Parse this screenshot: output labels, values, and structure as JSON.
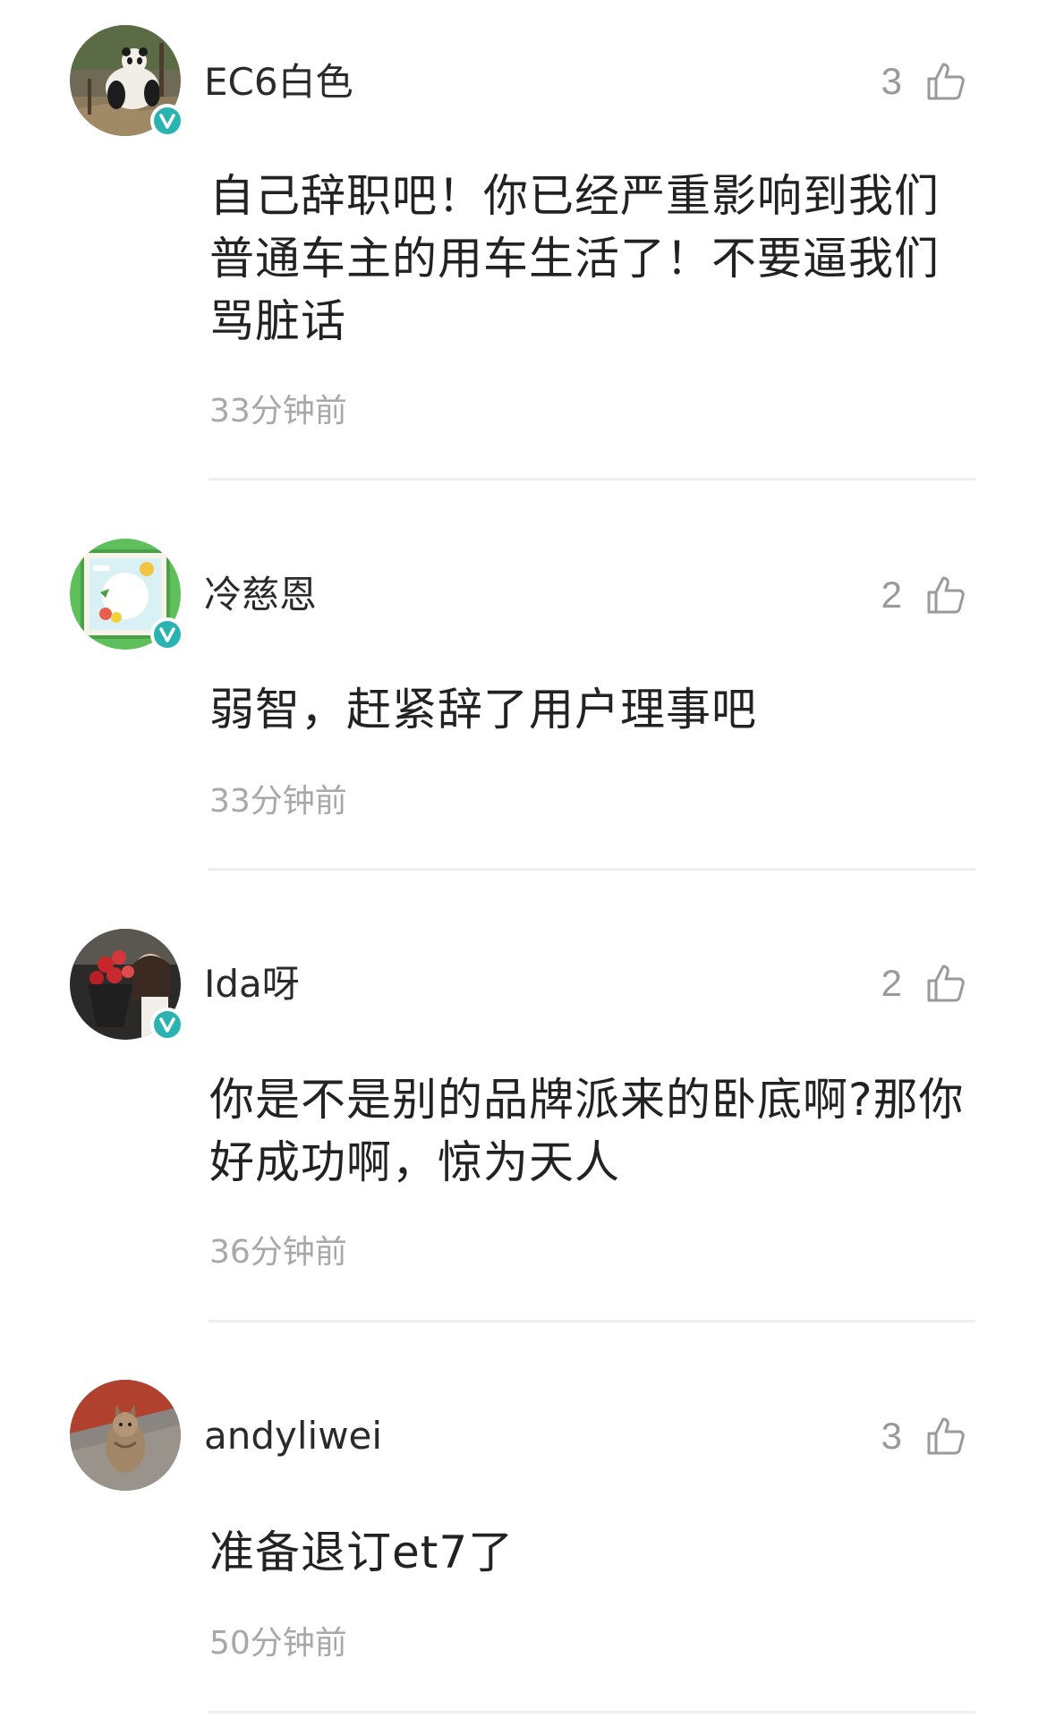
{
  "comments": [
    {
      "username": "EC6白色",
      "likes": "3",
      "content": "自己辞职吧！你已经严重影响到我们普通车主的用车生活了！不要逼我们骂脏话",
      "time": "33分钟前",
      "verified": true,
      "avatar": "panda-photo"
    },
    {
      "username": "冷慈恩",
      "likes": "2",
      "content": "弱智，赶紧辞了用户理事吧",
      "time": "33分钟前",
      "verified": true,
      "avatar": "cartoon-frame"
    },
    {
      "username": "Ida呀",
      "likes": "2",
      "content": "你是不是别的品牌派来的卧底啊?那你好成功啊，惊为天人",
      "time": "36分钟前",
      "verified": true,
      "avatar": "flowers-portrait"
    },
    {
      "username": "andyliwei",
      "likes": "3",
      "content": "准备退订et7了",
      "time": "50分钟前",
      "verified": false,
      "avatar": "cat-photo"
    }
  ],
  "colors": {
    "verified_badge": "#2bb3b1",
    "meta_text": "#a8a8a8",
    "divider": "#eeeeee"
  },
  "icons": {
    "like": "thumbs-up-icon",
    "verified": "verified-v-icon"
  }
}
